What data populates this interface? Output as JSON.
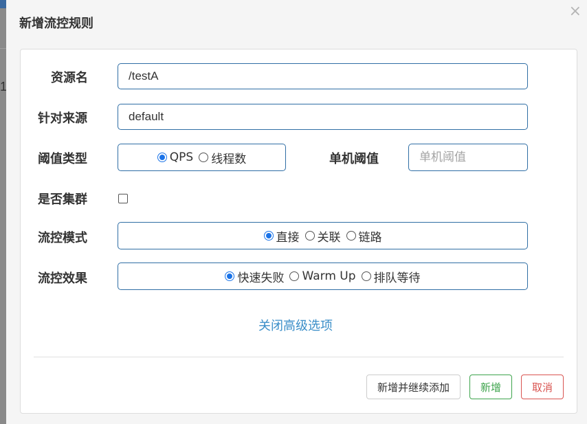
{
  "background": {
    "partial_digit": "1"
  },
  "dialog": {
    "title": "新增流控规则",
    "close_glyph": "×"
  },
  "form": {
    "resource": {
      "label": "资源名",
      "value": "/testA"
    },
    "source": {
      "label": "针对来源",
      "value": "default"
    },
    "threshold_type": {
      "label": "阈值类型",
      "options": [
        {
          "label": "QPS",
          "checked": true
        },
        {
          "label": "线程数",
          "checked": false
        }
      ]
    },
    "single_threshold": {
      "label": "单机阈值",
      "placeholder": "单机阈值",
      "value": ""
    },
    "cluster": {
      "label": "是否集群",
      "checked": false
    },
    "control_mode": {
      "label": "流控模式",
      "options": [
        {
          "label": "直接",
          "checked": true
        },
        {
          "label": "关联",
          "checked": false
        },
        {
          "label": "链路",
          "checked": false
        }
      ]
    },
    "control_effect": {
      "label": "流控效果",
      "options": [
        {
          "label": "快速失败",
          "checked": true
        },
        {
          "label": "Warm Up",
          "checked": false
        },
        {
          "label": "排队等待",
          "checked": false
        }
      ]
    },
    "advanced_toggle": "关闭高级选项"
  },
  "footer": {
    "add_continue": "新增并继续添加",
    "add": "新增",
    "cancel": "取消"
  },
  "colors": {
    "input_border": "#2e6da4",
    "radio_checked": "#1a73e8",
    "link": "#3a8ec8",
    "success": "#3ca34b",
    "danger": "#d9534f"
  }
}
